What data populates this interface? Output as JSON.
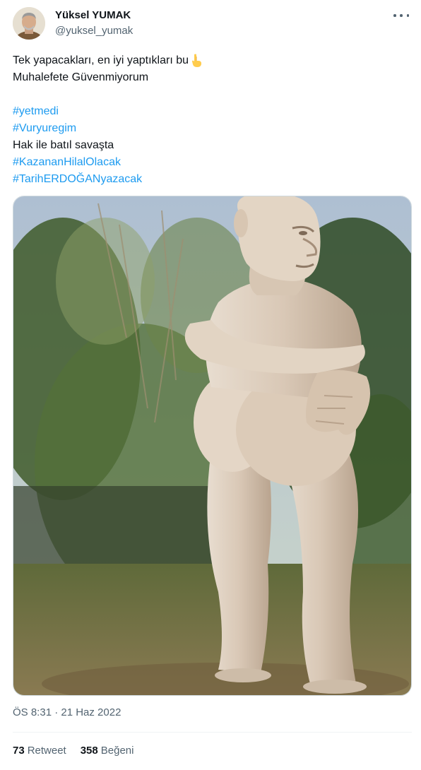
{
  "author": {
    "name": "Yüksel YUMAK",
    "handle": "@yuksel_yumak"
  },
  "tweet": {
    "line1": "Tek yapacakları, en iyi yaptıkları bu",
    "line1_emoji": "pointing-down-emoji",
    "line2": "Muhalefete Güvenmiyorum",
    "hashtag1": "#yetmedi",
    "hashtag2": "#Vuryuregim",
    "line3": "Hak ile batıl savaşta",
    "hashtag3": "#KazananHilalOlacak",
    "hashtag4": "#TarihERDOĞANyazacak"
  },
  "media": {
    "icon": "photo-statue"
  },
  "meta": {
    "timestamp": "ÖS 8:31 · 21 Haz 2022"
  },
  "stats": {
    "retweets_count": "73",
    "retweets_label": "Retweet",
    "likes_count": "358",
    "likes_label": "Beğeni"
  },
  "colors": {
    "link": "#1d9bf0",
    "secondary_text": "#536471",
    "primary_text": "#0f1419"
  }
}
